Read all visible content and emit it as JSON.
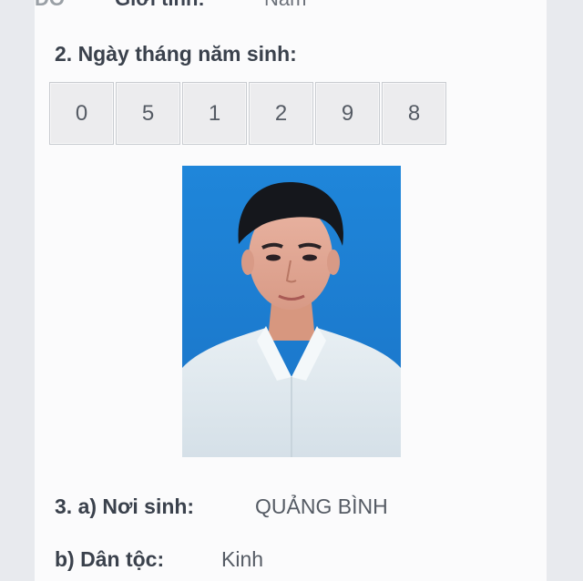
{
  "prev_row": {
    "left_fragment": "DÒ",
    "label_fragment": "Giới tính:",
    "value_fragment": "Nam"
  },
  "dob": {
    "label": "2. Ngày tháng năm sinh:",
    "digits": [
      "0",
      "5",
      "1",
      "2",
      "9",
      "8"
    ]
  },
  "photo": {
    "icon": "portrait-photo",
    "background_color": "#1b7fd4",
    "shirt_color": "#dfe8ee"
  },
  "birthplace": {
    "label": "3. a) Nơi sinh:",
    "value": "QUẢNG BÌNH"
  },
  "ethnicity": {
    "label": "b) Dân tộc:",
    "value": "Kinh"
  }
}
